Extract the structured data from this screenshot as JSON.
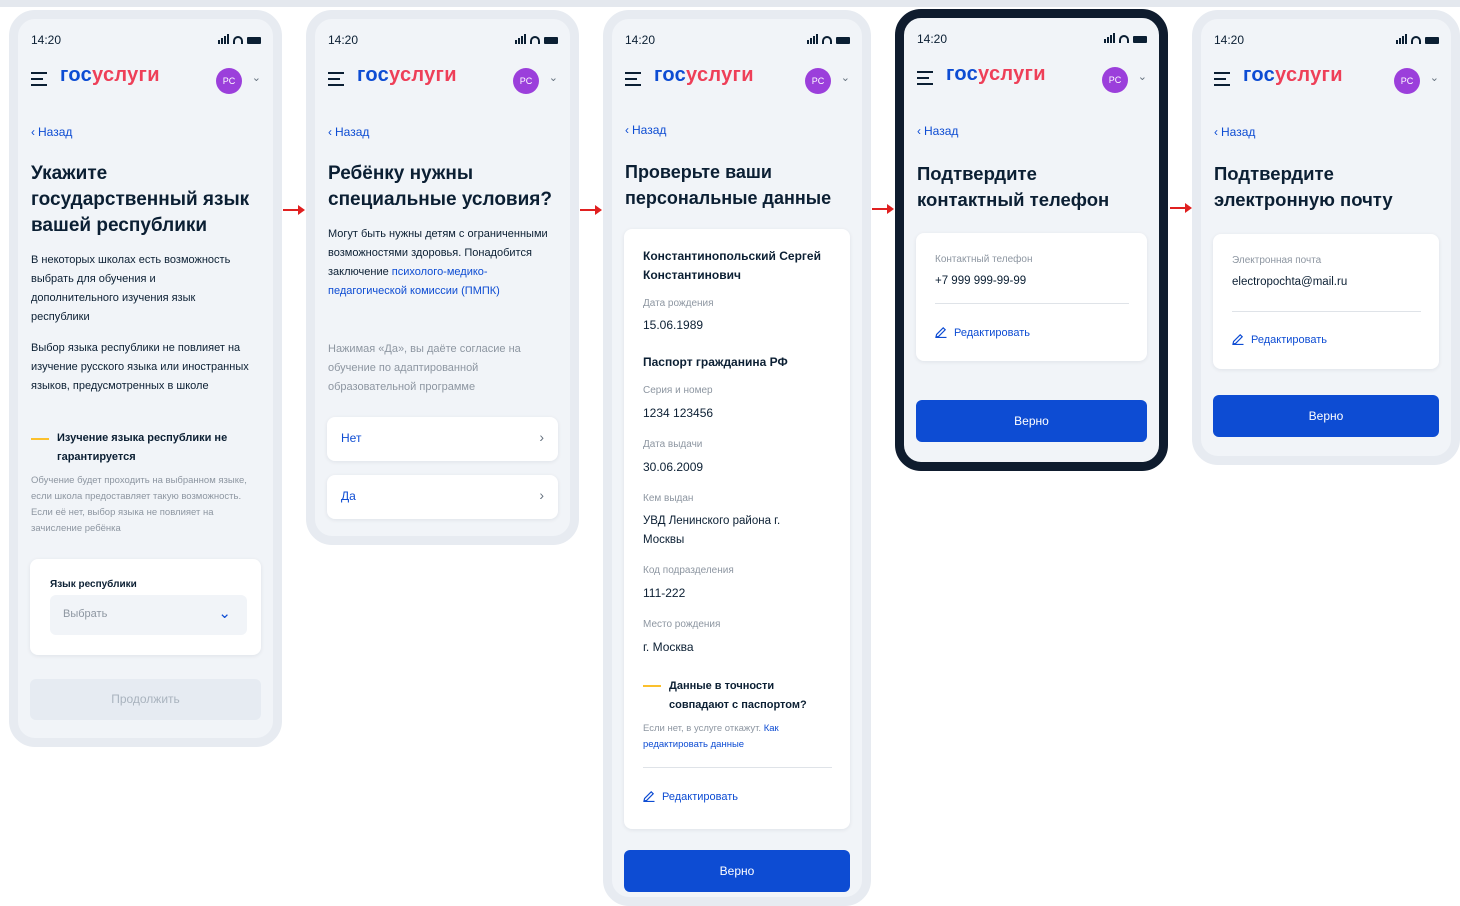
{
  "common": {
    "time": "14:20",
    "logo_part1": "гос",
    "logo_part2": "услуги",
    "avatar_initials": "PC",
    "back_label": "Назад"
  },
  "screen1": {
    "title": "Укажите государственный язык вашей республики",
    "intro": "В некоторых школах есть возможность выбрать для обучения и дополнительного изучения язык республики",
    "para2": "Выбор языка республики не повлияет на изучение русского языка или иностранных языков, предусмотренных в школе",
    "note_title": "Изучение языка республики не гарантируется",
    "note_text": "Обучение будет проходить на выбранном языке, если школа предоставляет такую возможность. Если её нет, выбор языка не повлияет на зачисление ребёнка",
    "select_label": "Язык республики",
    "select_placeholder": "Выбрать",
    "continue_label": "Продолжить"
  },
  "screen2": {
    "title": "Ребёнку нужны специальные условия?",
    "text_pre": "Могут быть нужны детям с ограниченными возможностями здоровья. Понадобится заключение",
    "text_link": "психолого-медико-педагогической комиссии (ПМПК)",
    "consent": "Нажимая «Да», вы даёте согласие на обучение по адаптированной образовательной программе",
    "option_no": "Нет",
    "option_yes": "Да"
  },
  "screen3": {
    "title": "Проверьте ваши персональные данные",
    "full_name": "Константинопольский Сергей Константинович",
    "birth_label": "Дата рождения",
    "birth_value": "15.06.1989",
    "passport_heading": "Паспорт гражданина РФ",
    "series_label": "Серия и номер",
    "series_value": "1234 123456",
    "issued_label": "Дата выдачи",
    "issued_value": "30.06.2009",
    "issuer_label": "Кем выдан",
    "issuer_value": "УВД Ленинского района г. Москвы",
    "code_label": "Код подразделения",
    "code_value": "111-222",
    "place_label": "Место рождения",
    "place_value": "г. Москва",
    "note_title": "Данные в точности совпадают с паспортом?",
    "note_text": "Если нет, в услуге откажут.",
    "note_link": "Как редактировать данные",
    "edit_label": "Редактировать",
    "confirm_label": "Верно"
  },
  "screen4": {
    "title": "Подтвердите контактный телефон",
    "phone_label": "Контактный телефон",
    "phone_value": "+7 999 999-99-99",
    "edit_label": "Редактировать",
    "confirm_label": "Верно"
  },
  "screen5": {
    "title": "Подтвердите электронную почту",
    "email_label": "Электронная почта",
    "email_value": "electropochta@mail.ru",
    "edit_label": "Редактировать",
    "confirm_label": "Верно"
  },
  "colors": {
    "primary": "#0d4cd3",
    "logo_red": "#ee3f58",
    "avatar": "#9b3fdb",
    "warning_dash": "#fbc02d",
    "flow_arrow": "#e02020",
    "active_frame": "#0f1c2e"
  }
}
